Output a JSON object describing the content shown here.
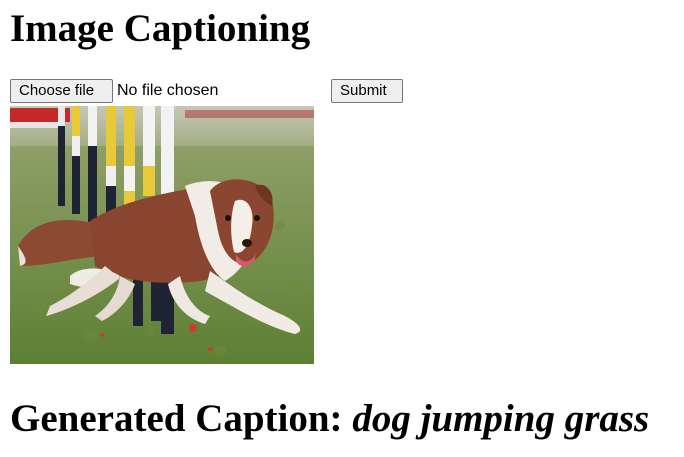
{
  "header": {
    "title": "Image Captioning"
  },
  "upload_form": {
    "choose_file_label": "Choose file",
    "file_status": "No file chosen",
    "submit_label": "Submit"
  },
  "result": {
    "caption_label": "Generated Caption:",
    "caption_text": "dog jumping grass"
  }
}
